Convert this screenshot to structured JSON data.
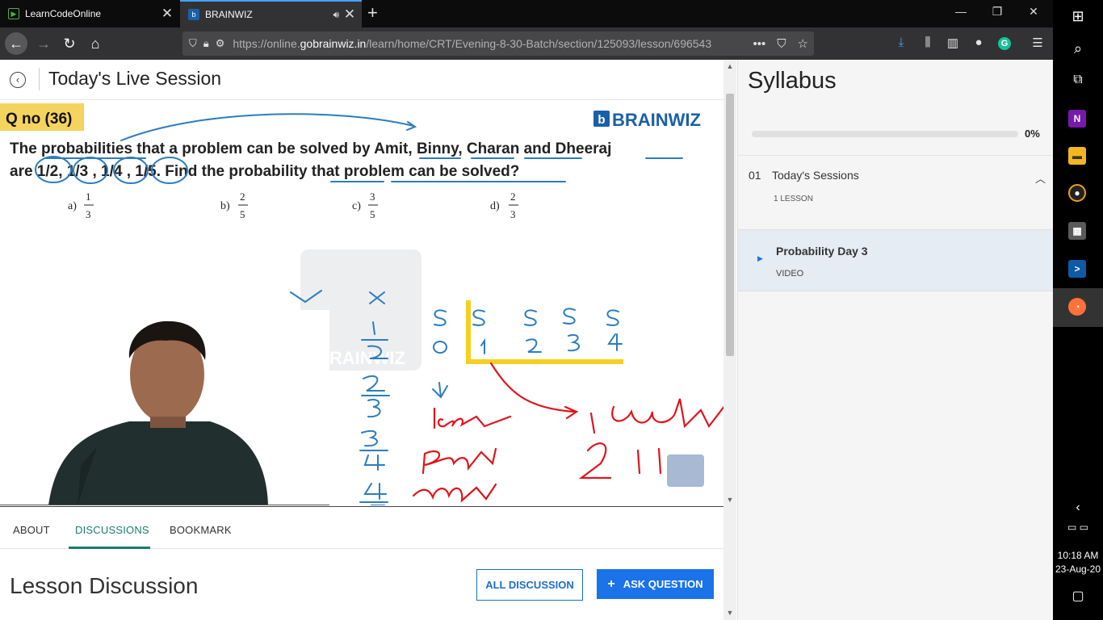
{
  "browser": {
    "tabs": [
      {
        "title": "LearnCodeOnline",
        "favicon": "play-icon"
      },
      {
        "title": "BRAINWIZ",
        "favicon": "brainwiz-icon",
        "active": true,
        "audio": true
      }
    ],
    "url_prefix": "https://online.",
    "url_domain": "gobrainwiz.in",
    "url_path": "/learn/home/CRT/Evening-8-30-Batch/section/125093/lesson/696543",
    "url_more": "•••"
  },
  "header": {
    "title": "Today's Live Session"
  },
  "video": {
    "question_label": "Q no (36)",
    "brand": "BRAINWIZ",
    "question_line1": "The probabilities that a problem can be solved by Amit, Binny, Charan and Dheeraj",
    "question_line2": "are 1/2, 1/3 , 1/4 , 1/5. Find the probability that problem can be solved?",
    "options": [
      {
        "label": "a)",
        "num": "1",
        "den": "3"
      },
      {
        "label": "b)",
        "num": "2",
        "den": "5"
      },
      {
        "label": "c)",
        "num": "3",
        "den": "5"
      },
      {
        "label": "d)",
        "num": "2",
        "den": "3"
      }
    ],
    "watermark": "BRAINWIZ"
  },
  "page_tabs": {
    "about": "ABOUT",
    "discussions": "DISCUSSIONS",
    "bookmark": "BOOKMARK"
  },
  "discussion": {
    "title": "Lesson Discussion",
    "all_button": "ALL DISCUSSION",
    "ask_button": "ASK QUESTION",
    "ask_icon": "+"
  },
  "syllabus": {
    "title": "Syllabus",
    "progress": 0,
    "progress_label": "0%",
    "section_number": "01",
    "section_name": "Today's Sessions",
    "section_count": "1 LESSON",
    "lesson_name": "Probability Day 3",
    "lesson_type": "VIDEO"
  },
  "taskbar": {
    "time": "10:18 AM",
    "date": "23-Aug-20"
  },
  "colors": {
    "accent": "#1a7d6f",
    "button_blue": "#1a73e8",
    "ink_blue": "#2c7cc0",
    "ink_red": "#e0141c",
    "highlight_yellow": "#f5d020"
  }
}
